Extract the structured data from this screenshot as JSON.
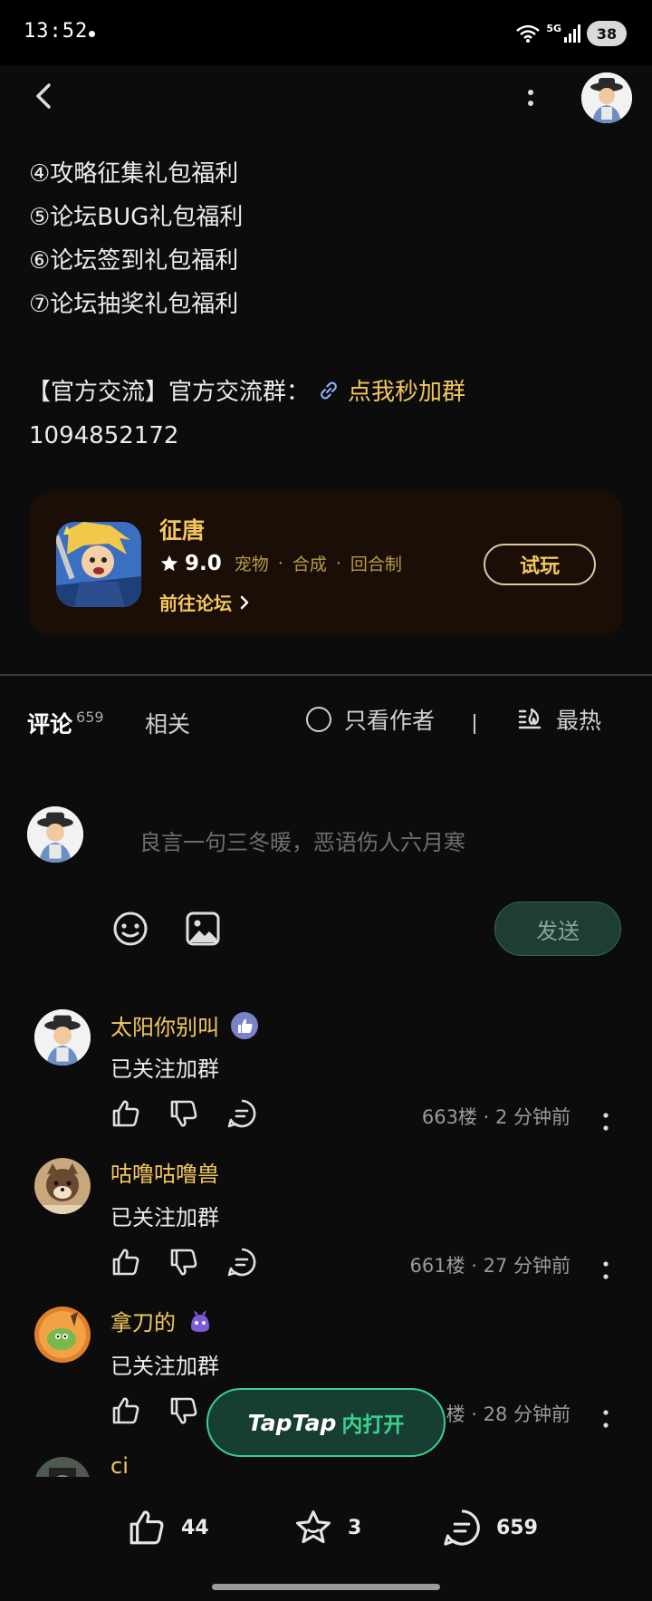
{
  "status_bar": {
    "time": "13:52",
    "network": "5G",
    "battery": "38"
  },
  "post": {
    "lines": [
      "④攻略征集礼包福利",
      "⑤论坛BUG礼包福利",
      "⑥论坛签到礼包福利",
      "⑦论坛抽奖礼包福利"
    ],
    "group_prefix": "【官方交流】官方交流群：",
    "group_link": "点我秒加群",
    "group_number": "1094852172"
  },
  "game_card": {
    "name": "征唐",
    "score": "9.0",
    "tags": [
      "宠物",
      "合成",
      "回合制"
    ],
    "separator": "·",
    "forum_link": "前往论坛",
    "try_button": "试玩"
  },
  "tabs": {
    "comments_label": "评论",
    "comments_count": "659",
    "related_label": "相关",
    "author_only_label": "只看作者",
    "sort_label": "最热"
  },
  "compose": {
    "placeholder": "良言一句三冬暖，恶语伤人六月寒",
    "send_label": "发送"
  },
  "comments": [
    {
      "name": "太阳你别叫",
      "text": "已关注加群",
      "meta": "663楼 · 2 分钟前"
    },
    {
      "name": "咕噜咕噜兽",
      "text": "已关注加群",
      "meta": "661楼 · 27 分钟前"
    },
    {
      "name": "拿刀的",
      "text": "已关注加群",
      "meta": "楼 · 28 分钟前"
    },
    {
      "name": "ci"
    }
  ],
  "taptap_button": {
    "logo": "TapTap",
    "suffix": "内打开"
  },
  "bottom_bar": {
    "likes": "44",
    "favorites": "3",
    "comments": "659"
  },
  "colors": {
    "accent_gold": "#f3c75f",
    "accent_green": "#3bd08f",
    "background": "#0c0c0c"
  }
}
